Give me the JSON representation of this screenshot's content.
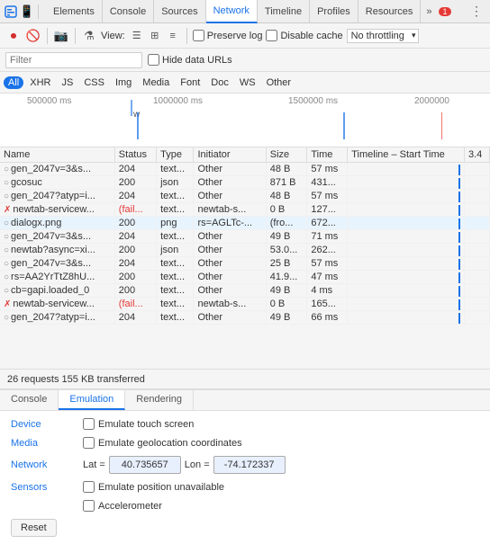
{
  "topbar": {
    "tabs": [
      {
        "label": "Elements",
        "active": false
      },
      {
        "label": "Console",
        "active": false
      },
      {
        "label": "Sources",
        "active": false
      },
      {
        "label": "Network",
        "active": true
      },
      {
        "label": "Timeline",
        "active": false
      },
      {
        "label": "Profiles",
        "active": false
      },
      {
        "label": "Resources",
        "active": false
      }
    ],
    "more_label": "»",
    "alert_count": "1",
    "dots": "⋮"
  },
  "toolbar": {
    "view_label": "View:",
    "preserve_log": "Preserve log",
    "disable_cache": "Disable cache",
    "throttle": "No throttling"
  },
  "filter": {
    "placeholder": "Filter",
    "hide_data_urls": "Hide data URLs"
  },
  "type_filters": [
    "All",
    "XHR",
    "JS",
    "CSS",
    "Img",
    "Media",
    "Font",
    "Doc",
    "WS",
    "Other"
  ],
  "timeline_labels": [
    "500000 ms",
    "1000000 ms",
    "1500000 ms",
    "2000000"
  ],
  "table_headers": [
    "Name",
    "Status",
    "Type",
    "Initiator",
    "Size",
    "Time",
    "Timeline – Start Time"
  ],
  "table_rows": [
    {
      "name": "gen_2047v=3&s...",
      "status": "204",
      "type": "text...",
      "initiator": "Other",
      "size": "48 B",
      "time": "57 ms",
      "fail": false
    },
    {
      "name": "gcosuc",
      "status": "200",
      "type": "json",
      "initiator": "Other",
      "size": "871 B",
      "time": "431...",
      "fail": false
    },
    {
      "name": "gen_2047?atyp=i...",
      "status": "204",
      "type": "text...",
      "initiator": "Other",
      "size": "48 B",
      "time": "57 ms",
      "fail": false
    },
    {
      "name": "newtab-servicew...",
      "status": "(fail...",
      "type": "text...",
      "initiator": "newtab-s...",
      "size": "0 B",
      "time": "127...",
      "fail": true
    },
    {
      "name": "dialogx.png",
      "status": "200",
      "type": "png",
      "initiator": "rs=AGLTc-...",
      "size": "(fro...",
      "time": "672...",
      "fail": false
    },
    {
      "name": "gen_2047v=3&s...",
      "status": "204",
      "type": "text...",
      "initiator": "Other",
      "size": "49 B",
      "time": "71 ms",
      "fail": false
    },
    {
      "name": "newtab?async=xi...",
      "status": "200",
      "type": "json",
      "initiator": "Other",
      "size": "53.0...",
      "time": "262...",
      "fail": false
    },
    {
      "name": "gen_2047v=3&s...",
      "status": "204",
      "type": "text...",
      "initiator": "Other",
      "size": "25 B",
      "time": "57 ms",
      "fail": false
    },
    {
      "name": "rs=AA2YrTtZ8hU...",
      "status": "200",
      "type": "text...",
      "initiator": "Other",
      "size": "41.9...",
      "time": "47 ms",
      "fail": false
    },
    {
      "name": "cb=gapi.loaded_0",
      "status": "200",
      "type": "text...",
      "initiator": "Other",
      "size": "49 B",
      "time": "4 ms",
      "fail": false
    },
    {
      "name": "newtab-servicew...",
      "status": "(fail...",
      "type": "text...",
      "initiator": "newtab-s...",
      "size": "0 B",
      "time": "165...",
      "fail": true
    },
    {
      "name": "gen_2047?atyp=i...",
      "status": "204",
      "type": "text...",
      "initiator": "Other",
      "size": "49 B",
      "time": "66 ms",
      "fail": false
    }
  ],
  "status_bar": {
    "text": "26 requests  155 KB transferred"
  },
  "bottom_tabs": [
    "Console",
    "Emulation",
    "Rendering"
  ],
  "active_bottom_tab": "Emulation",
  "emulation": {
    "device_label": "Device",
    "touch_label": "Emulate touch screen",
    "media_label": "Media",
    "geo_label": "Emulate geolocation coordinates",
    "network_label": "Network",
    "lat_label": "Lat =",
    "lat_value": "40.735657",
    "lon_label": "Lon =",
    "lon_value": "-74.172337",
    "sensors_label": "Sensors",
    "position_label": "Emulate position unavailable",
    "accelerometer_label": "Accelerometer",
    "reset_label": "Reset"
  }
}
